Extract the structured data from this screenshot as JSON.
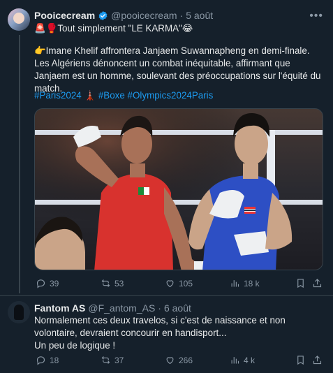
{
  "tweet": {
    "author_name": "Pooicecream",
    "author_handle": "@pooicecream",
    "date": "5 août",
    "line1": "🚨🥊Tout simplement \"LE KARMA\"😂",
    "line2": "👉Imane Khelif affrontera Janjaem Suwannapheng en demi-finale. Les Algériens dénoncent un combat inéquitable, affirmant que Janjaem est un homme, soulevant des préoccupations sur l'équité du match.",
    "hashtags": "#Paris2024 🗼 #Boxe #Olympics2024Paris",
    "stats": {
      "replies": "39",
      "reposts": "53",
      "likes": "105",
      "views": "18 k"
    }
  },
  "reply": {
    "author_name": "Fantom AS",
    "author_handle": "@F_antom_AS",
    "date": "6 août",
    "text": "Normalement ces deux travelos, si c'est de naissance et non volontaire, devraient concourir en handisport...\nUn peu de logique !",
    "stats": {
      "replies": "18",
      "reposts": "37",
      "likes": "266",
      "views": "4 k"
    }
  },
  "colors": {
    "background": "#15202b",
    "accent": "#1d9bf0",
    "muted": "#8b98a5",
    "text": "#e7e9ea"
  },
  "icons": {
    "verified": "verified-badge-icon",
    "more": "more-icon",
    "reply": "reply-icon",
    "repost": "repost-icon",
    "like": "heart-icon",
    "views": "views-icon",
    "bookmark": "bookmark-icon",
    "share": "share-icon"
  }
}
